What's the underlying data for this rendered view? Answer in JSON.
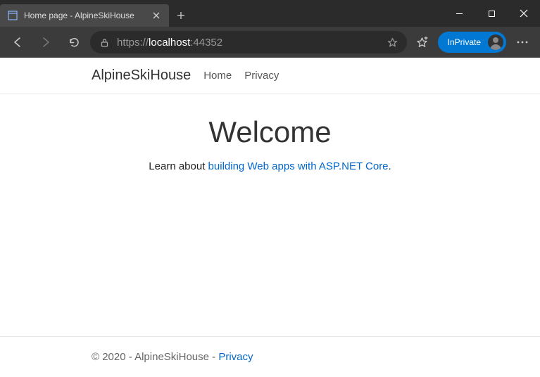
{
  "browser": {
    "tab_title": "Home page - AlpineSkiHouse",
    "url_scheme": "https://",
    "url_host": "localhost",
    "url_port": ":44352",
    "inprivate_label": "InPrivate"
  },
  "site": {
    "brand": "AlpineSkiHouse",
    "nav": {
      "home": "Home",
      "privacy": "Privacy"
    },
    "heading": "Welcome",
    "learn_prefix": "Learn about ",
    "learn_link": "building Web apps with ASP.NET Core",
    "footer_text": "© 2020 - AlpineSkiHouse - ",
    "footer_link": "Privacy"
  }
}
